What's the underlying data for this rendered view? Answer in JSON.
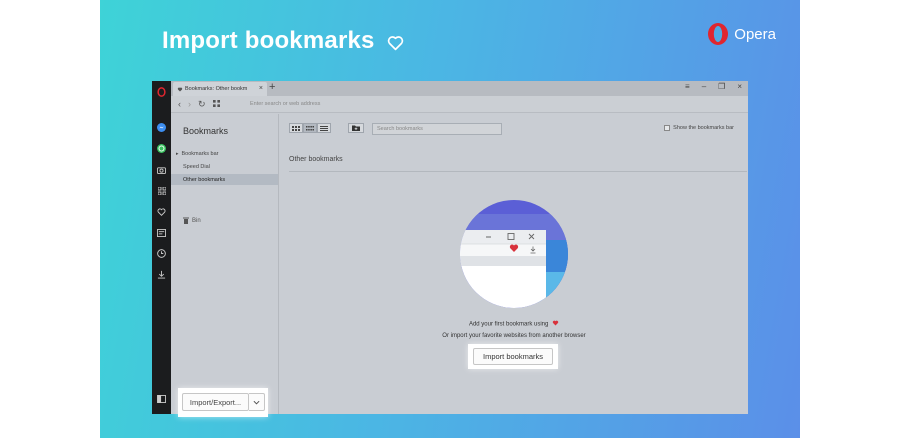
{
  "headline": "Import bookmarks",
  "brand": "Opera",
  "browser": {
    "tab_title": "Bookmarks: Other bookm",
    "new_tab": "+",
    "address_placeholder": "Enter search or web address",
    "window_controls": [
      "≡",
      "–",
      "❐",
      "×"
    ]
  },
  "left_panel": {
    "title": "Bookmarks",
    "items": [
      "Bookmarks bar",
      "Speed Dial",
      "Other bookmarks"
    ],
    "selected_item": "Other bookmarks",
    "bin_label": "Bin",
    "import_export_label": "Import/Export..."
  },
  "main": {
    "search_placeholder": "Search bookmarks",
    "show_bar_label": "Show the bookmarks bar",
    "heading": "Other bookmarks",
    "message_line1": "Add your first bookmark using",
    "message_line2": "Or import your favorite websites from another browser",
    "import_button_label": "Import bookmarks"
  },
  "colors": {
    "gradient_start": "#3ed3d7",
    "gradient_end": "#5b8fe8",
    "opera_red": "#e0262f",
    "heart_red": "#d8323c",
    "circle_purple": "#5b5fd6",
    "circle_blue": "#3a86d9"
  },
  "icons": [
    "heart-outline-icon",
    "opera-logo-icon",
    "messenger-icon",
    "whatsapp-icon",
    "camera-icon",
    "grid-icon",
    "heart-icon",
    "news-icon",
    "history-icon",
    "download-icon",
    "sidebar-toggle-icon",
    "back-icon",
    "forward-icon",
    "reload-icon",
    "speed-dial-icon",
    "trash-icon",
    "folder-add-icon",
    "chevron-down-icon"
  ]
}
